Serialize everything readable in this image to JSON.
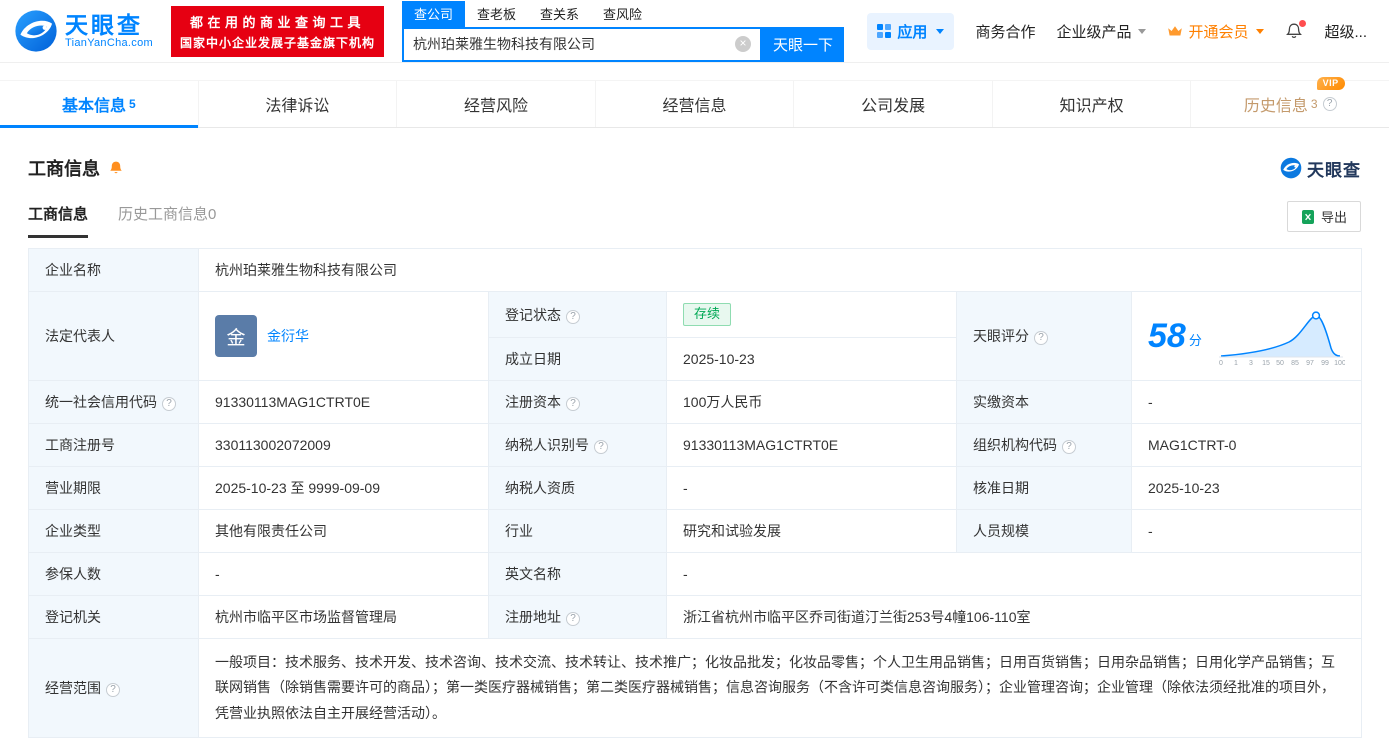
{
  "header": {
    "logo": {
      "brand": "天眼查",
      "domain": "TianYanCha.com"
    },
    "banner": {
      "line1": "都在用的商业查询工具",
      "line2": "国家中小企业发展子基金旗下机构"
    },
    "search_tabs": [
      {
        "label": "查公司"
      },
      {
        "label": "查老板"
      },
      {
        "label": "查关系"
      },
      {
        "label": "查风险"
      }
    ],
    "search": {
      "value": "杭州珀莱雅生物科技有限公司",
      "button_label": "天眼一下"
    },
    "nav": {
      "apps": "应用",
      "cooperation": "商务合作",
      "enterprise": "企业级产品",
      "vip": "开通会员",
      "super": "超级..."
    }
  },
  "tabs": {
    "basic": {
      "label": "基本信息",
      "count": "5"
    },
    "legal": {
      "label": "法律诉讼"
    },
    "risk": {
      "label": "经营风险"
    },
    "operation": {
      "label": "经营信息"
    },
    "development": {
      "label": "公司发展"
    },
    "ip": {
      "label": "知识产权"
    },
    "history": {
      "label": "历史信息",
      "count": "3",
      "vip_badge": "VIP"
    }
  },
  "section": {
    "title": "工商信息",
    "watermark": "天眼查",
    "subtab_active": "工商信息",
    "subtab_history": "历史工商信息0",
    "export_label": "导出"
  },
  "info": {
    "company_name": {
      "label": "企业名称",
      "value": "杭州珀莱雅生物科技有限公司"
    },
    "legal_rep": {
      "label": "法定代表人",
      "avatar": "金",
      "name": "金衍华"
    },
    "reg_status": {
      "label": "登记状态",
      "value": "存续"
    },
    "establish_date": {
      "label": "成立日期",
      "value": "2025-10-23"
    },
    "score": {
      "label": "天眼评分",
      "value": "58",
      "unit": "分"
    },
    "credit_code": {
      "label": "统一社会信用代码",
      "value": "91330113MAG1CTRT0E"
    },
    "reg_capital": {
      "label": "注册资本",
      "value": "100万人民币"
    },
    "paid_capital": {
      "label": "实缴资本",
      "value": "-"
    },
    "reg_no": {
      "label": "工商注册号",
      "value": "330113002072009"
    },
    "taxpayer_no": {
      "label": "纳税人识别号",
      "value": "91330113MAG1CTRT0E"
    },
    "org_code": {
      "label": "组织机构代码",
      "value": "MAG1CTRT-0"
    },
    "term": {
      "label": "营业期限",
      "value": "2025-10-23 至 9999-09-09"
    },
    "taxpayer_quality": {
      "label": "纳税人资质",
      "value": "-"
    },
    "approve_date": {
      "label": "核准日期",
      "value": "2025-10-23"
    },
    "company_type": {
      "label": "企业类型",
      "value": "其他有限责任公司"
    },
    "industry": {
      "label": "行业",
      "value": "研究和试验发展"
    },
    "staff_size": {
      "label": "人员规模",
      "value": "-"
    },
    "insured": {
      "label": "参保人数",
      "value": "-"
    },
    "english_name": {
      "label": "英文名称",
      "value": "-"
    },
    "authority": {
      "label": "登记机关",
      "value": "杭州市临平区市场监督管理局"
    },
    "address": {
      "label": "注册地址",
      "value": "浙江省杭州市临平区乔司街道汀兰街253号4幢106-110室"
    },
    "scope": {
      "label": "经营范围",
      "value": "一般项目：技术服务、技术开发、技术咨询、技术交流、技术转让、技术推广；化妆品批发；化妆品零售；个人卫生用品销售；日用百货销售；日用杂品销售；日用化学产品销售；互联网销售（除销售需要许可的商品）；第一类医疗器械销售；第二类医疗器械销售；信息咨询服务（不含许可类信息咨询服务）；企业管理咨询；企业管理（除依法须经批准的项目外，凭营业执照依法自主开展经营活动）。"
    }
  },
  "score_chart": {
    "ticks": [
      "0",
      "1",
      "3",
      "15",
      "50",
      "85",
      "97",
      "99",
      "100"
    ]
  },
  "colors": {
    "brand_blue": "#0084ff",
    "banner_red": "#e60012",
    "status_green": "#00a854",
    "history_gold": "#c49a6c",
    "vip_orange": "#ff8000",
    "label_bg": "#f2f8fd"
  }
}
